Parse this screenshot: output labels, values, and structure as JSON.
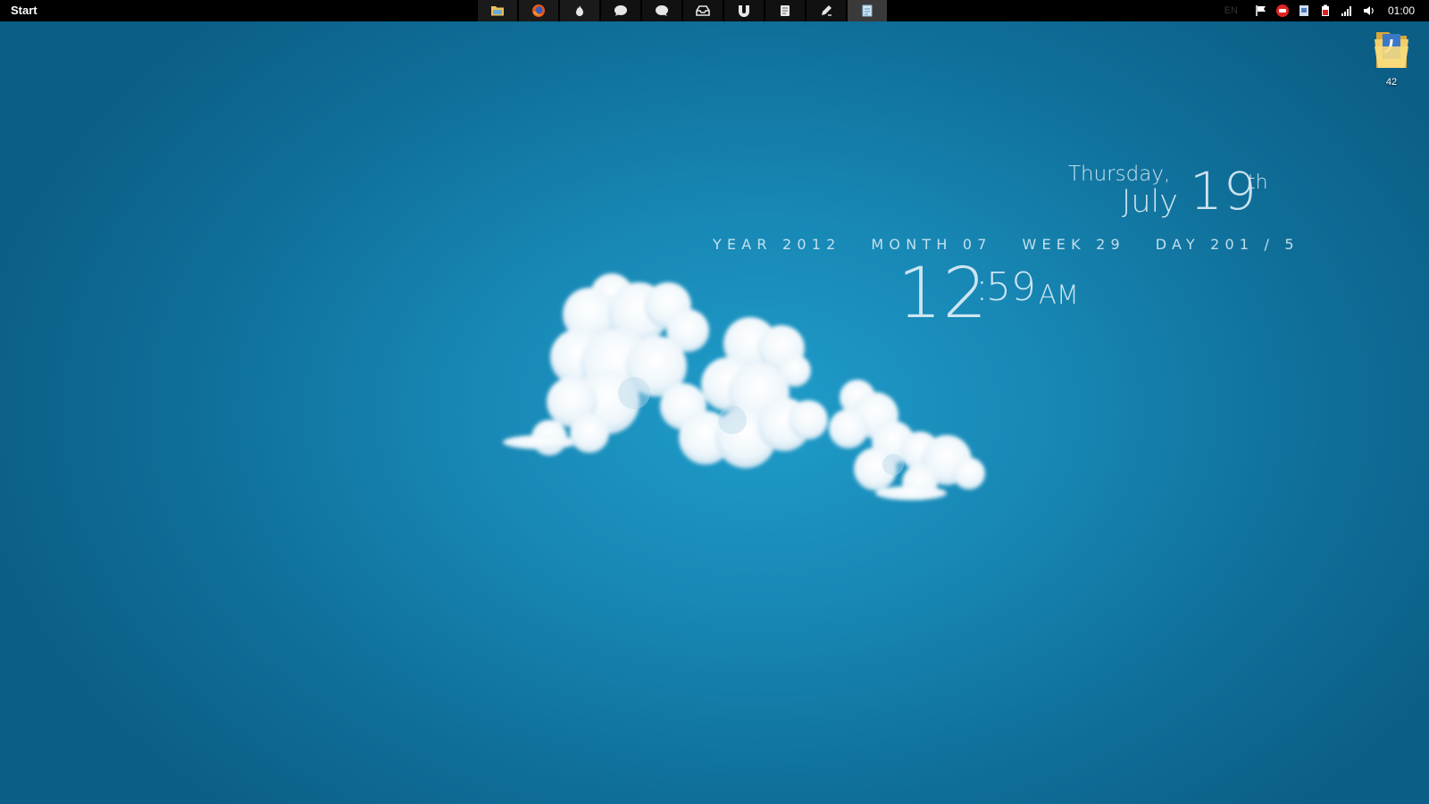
{
  "taskbar": {
    "start_label": "Start",
    "task_buttons": [
      {
        "icon": "folder-icon",
        "state": "normal"
      },
      {
        "icon": "firefox-icon",
        "state": "normal"
      },
      {
        "icon": "flame-icon",
        "state": "normal"
      },
      {
        "icon": "chat-bubble-icon",
        "state": "dim"
      },
      {
        "icon": "chat-bubble-icon",
        "state": "dim"
      },
      {
        "icon": "inbox-icon",
        "state": "dim"
      },
      {
        "icon": "torrent-icon",
        "state": "dim"
      },
      {
        "icon": "document-icon",
        "state": "dim"
      },
      {
        "icon": "pencil-icon",
        "state": "dim"
      },
      {
        "icon": "notepad-icon",
        "state": "active"
      }
    ],
    "tray": {
      "language": "EN",
      "icons": [
        "flag-icon",
        "red-app-icon",
        "document-icon",
        "battery-icon",
        "signal-icon",
        "volume-icon"
      ],
      "clock": "01:00"
    }
  },
  "desktop": {
    "icon": {
      "name": "folder-icon",
      "label": "42"
    }
  },
  "widget": {
    "weekday": "Thursday,",
    "month": "July",
    "day": "19",
    "ordinal": "th",
    "stats": "YEAR 2012   MONTH 07   WEEK 29   DAY 201 / 5",
    "hour": "12",
    "colon": ":",
    "minutes": "59",
    "ampm": "AM"
  },
  "colors": {
    "background_center": "#1f9cca",
    "background_edge": "#0b5e86",
    "taskbar": "#000000",
    "widget_text": "#e1f0f8"
  }
}
